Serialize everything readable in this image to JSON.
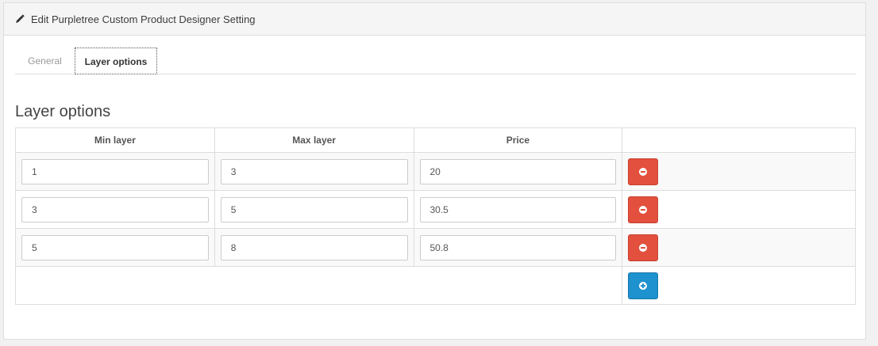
{
  "header": {
    "title": "Edit Purpletree Custom Product Designer Setting",
    "icon": "pencil-icon"
  },
  "tabs": [
    {
      "label": "General",
      "active": false
    },
    {
      "label": "Layer options",
      "active": true
    }
  ],
  "section_title": "Layer options",
  "table": {
    "columns": [
      "Min layer",
      "Max layer",
      "Price",
      ""
    ],
    "rows": [
      {
        "min": "1",
        "max": "3",
        "price": "20"
      },
      {
        "min": "3",
        "max": "5",
        "price": "30.5"
      },
      {
        "min": "5",
        "max": "8",
        "price": "50.8"
      }
    ]
  },
  "colors": {
    "remove_button": "#e3503e",
    "add_button": "#1e91cf"
  }
}
